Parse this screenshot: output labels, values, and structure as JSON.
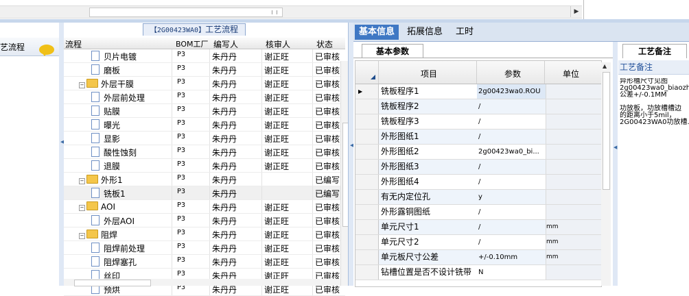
{
  "left_panel": {
    "title": "艺流程",
    "icon": "chat-bubble-icon"
  },
  "mid_panel": {
    "tab_code": "【2G00423WA0】",
    "tab_label": "工艺流程",
    "columns": [
      "流程",
      "BOM工厂",
      "编写人",
      "核审人",
      "状态"
    ],
    "rows": [
      {
        "name": "贝片电镀",
        "level": 2,
        "type": "doc",
        "bom": "P3",
        "writer": "朱丹丹",
        "reviewer": "谢正旺",
        "status": "已审核"
      },
      {
        "name": "磨板",
        "level": 2,
        "type": "doc",
        "bom": "P3",
        "writer": "朱丹丹",
        "reviewer": "谢正旺",
        "status": "已审核"
      },
      {
        "name": "外层干膜",
        "level": 1,
        "type": "folder",
        "bom": "P3",
        "writer": "朱丹丹",
        "reviewer": "谢正旺",
        "status": "已审核"
      },
      {
        "name": "外层前处理",
        "level": 2,
        "type": "doc",
        "bom": "P3",
        "writer": "朱丹丹",
        "reviewer": "谢正旺",
        "status": "已审核"
      },
      {
        "name": "贴膜",
        "level": 2,
        "type": "doc",
        "bom": "P3",
        "writer": "朱丹丹",
        "reviewer": "谢正旺",
        "status": "已审核"
      },
      {
        "name": "曝光",
        "level": 2,
        "type": "doc",
        "bom": "P3",
        "writer": "朱丹丹",
        "reviewer": "谢正旺",
        "status": "已审核"
      },
      {
        "name": "显影",
        "level": 2,
        "type": "doc",
        "bom": "P3",
        "writer": "朱丹丹",
        "reviewer": "谢正旺",
        "status": "已审核"
      },
      {
        "name": "酸性蚀刻",
        "level": 2,
        "type": "doc",
        "bom": "P3",
        "writer": "朱丹丹",
        "reviewer": "谢正旺",
        "status": "已审核"
      },
      {
        "name": "退膜",
        "level": 2,
        "type": "doc",
        "bom": "P3",
        "writer": "朱丹丹",
        "reviewer": "谢正旺",
        "status": "已审核"
      },
      {
        "name": "外形1",
        "level": 1,
        "type": "folder",
        "bom": "P3",
        "writer": "朱丹丹",
        "reviewer": "",
        "status": "已编写"
      },
      {
        "name": "铣板1",
        "level": 2,
        "type": "doc",
        "bom": "P3",
        "writer": "朱丹丹",
        "reviewer": "",
        "status": "已编写",
        "selected": true
      },
      {
        "name": "AOI",
        "level": 1,
        "type": "folder",
        "bom": "P3",
        "writer": "朱丹丹",
        "reviewer": "谢正旺",
        "status": "已审核"
      },
      {
        "name": "外层AOI",
        "level": 2,
        "type": "doc",
        "bom": "P3",
        "writer": "朱丹丹",
        "reviewer": "谢正旺",
        "status": "已审核"
      },
      {
        "name": "阻焊",
        "level": 1,
        "type": "folder",
        "bom": "P3",
        "writer": "朱丹丹",
        "reviewer": "谢正旺",
        "status": "已审核"
      },
      {
        "name": "阻焊前处理",
        "level": 2,
        "type": "doc",
        "bom": "P3",
        "writer": "朱丹丹",
        "reviewer": "谢正旺",
        "status": "已审核"
      },
      {
        "name": "阻焊塞孔",
        "level": 2,
        "type": "doc",
        "bom": "P3",
        "writer": "朱丹丹",
        "reviewer": "谢正旺",
        "status": "已审核"
      },
      {
        "name": "丝印",
        "level": 2,
        "type": "doc",
        "bom": "P3",
        "writer": "朱丹丹",
        "reviewer": "谢正旺",
        "status": "已审核"
      },
      {
        "name": "预烘",
        "level": 2,
        "type": "doc",
        "bom": "P3",
        "writer": "朱丹丹",
        "reviewer": "谢正旺",
        "status": "已审核"
      }
    ]
  },
  "right_panel": {
    "tabs": [
      {
        "label": "基本信息",
        "active": true
      },
      {
        "label": "拓展信息",
        "active": false
      },
      {
        "label": "工时",
        "active": false
      }
    ],
    "subtab": "基本参数",
    "grid_columns": [
      "项目",
      "参数",
      "单位"
    ],
    "params": [
      {
        "item": "铣板程序1",
        "value": "2g00423wa0.ROU",
        "unit": "",
        "current": true
      },
      {
        "item": "铣板程序2",
        "value": "/",
        "unit": ""
      },
      {
        "item": "铣板程序3",
        "value": "/",
        "unit": ""
      },
      {
        "item": "外形图纸1",
        "value": "/",
        "unit": ""
      },
      {
        "item": "外形图纸2",
        "value": "2g00423wa0_bi...",
        "unit": ""
      },
      {
        "item": "外形图纸3",
        "value": "/",
        "unit": ""
      },
      {
        "item": "外形图纸4",
        "value": "/",
        "unit": ""
      },
      {
        "item": "有无内定位孔",
        "value": "y",
        "unit": ""
      },
      {
        "item": "外形露铜图纸",
        "value": "/",
        "unit": ""
      },
      {
        "item": "单元尺寸1",
        "value": "/",
        "unit": "mm"
      },
      {
        "item": "单元尺寸2",
        "value": "/",
        "unit": "mm"
      },
      {
        "item": "单元板尺寸公差",
        "value": "+/-0.10mm",
        "unit": "mm"
      },
      {
        "item": "钻槽位置是否不设计铣带",
        "value": "N",
        "unit": ""
      }
    ],
    "notes_tab": "工艺备注",
    "notes_title": "工艺备注",
    "notes_text": "异形槽尺寸见图\n2g00423wa0_biaozh\n公差+/-0.1MM\n\n功放板，功放槽槽边\n的距离小于5mil，\n2G00423WA0功放槽."
  }
}
